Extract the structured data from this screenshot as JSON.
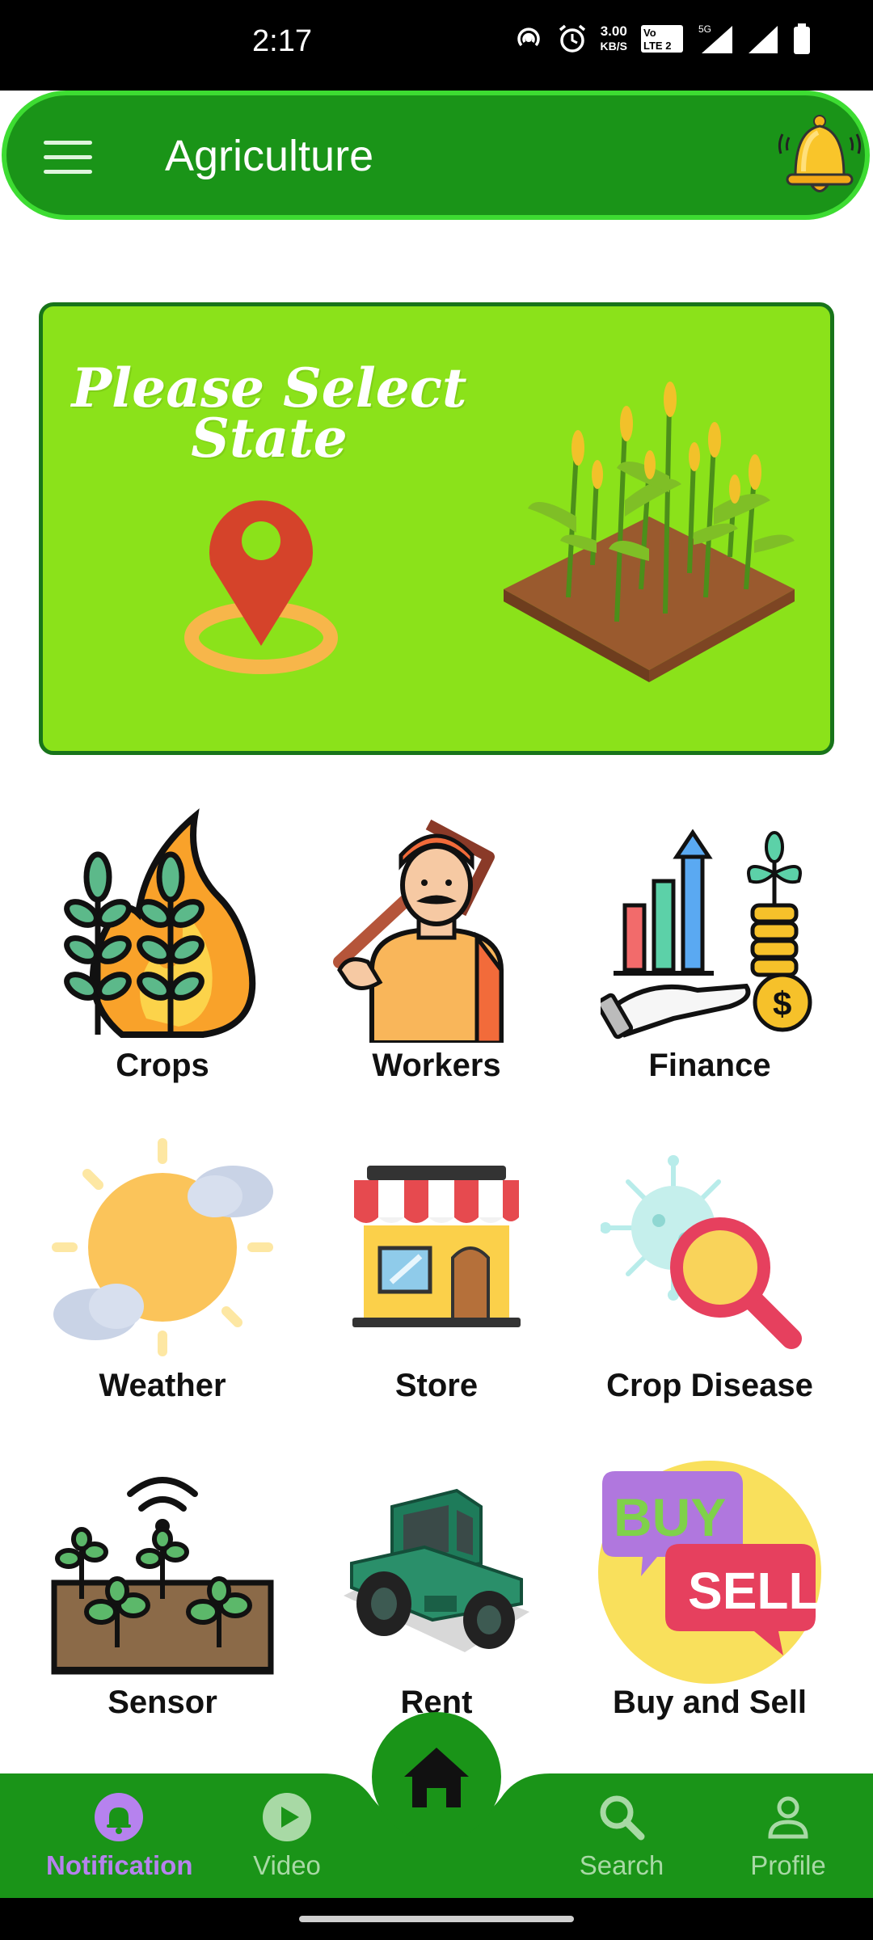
{
  "status_bar": {
    "time": "2:17",
    "net_speed_value": "3.00",
    "net_speed_unit": "KB/S",
    "volte": "Vo LTE 2",
    "network": "5G"
  },
  "app_bar": {
    "title": "Agriculture",
    "menu_icon": "hamburger-icon",
    "bell_icon": "bell-icon"
  },
  "banner": {
    "text_line1": "Please Select",
    "text_line2": "State"
  },
  "grid": [
    {
      "label": "Crops",
      "icon": "crops-fire-icon"
    },
    {
      "label": "Workers",
      "icon": "farmer-icon"
    },
    {
      "label": "Finance",
      "icon": "finance-icon"
    },
    {
      "label": "Weather",
      "icon": "weather-icon"
    },
    {
      "label": "Store",
      "icon": "store-icon"
    },
    {
      "label": "Crop Disease",
      "icon": "crop-disease-icon"
    },
    {
      "label": "Sensor",
      "icon": "sensor-icon"
    },
    {
      "label": "Rent",
      "icon": "tractor-icon"
    },
    {
      "label": "Buy and Sell",
      "icon": "buy-sell-icon"
    }
  ],
  "bottom_nav": {
    "items": [
      {
        "label": "Notification",
        "icon": "bell-icon",
        "active": true
      },
      {
        "label": "Video",
        "icon": "play-icon",
        "active": false
      },
      {
        "label": "Search",
        "icon": "search-icon",
        "active": false
      },
      {
        "label": "Profile",
        "icon": "profile-icon",
        "active": false
      }
    ],
    "home_icon": "home-icon"
  },
  "colors": {
    "primary_green": "#1a9418",
    "banner_green": "#8be21a",
    "active_nav": "#b682ee",
    "inactive_nav": "#a8d9a5"
  }
}
